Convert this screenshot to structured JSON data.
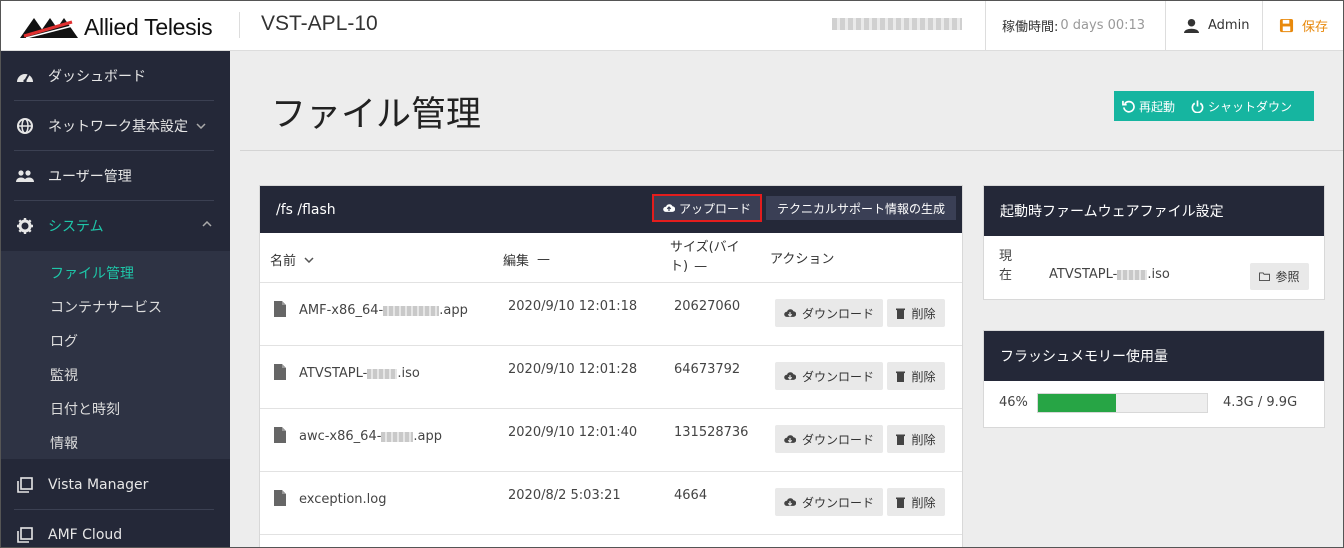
{
  "header": {
    "brand": "Allied Telesis",
    "hostname": "VST-APL-10",
    "uptime_label": "稼働時間:",
    "uptime_value": "0 days 00:13",
    "user": "Admin",
    "save": "保存"
  },
  "sidebar": {
    "items": [
      {
        "label": "ダッシュボード",
        "icon": "dashboard-icon"
      },
      {
        "label": "ネットワーク基本設定",
        "icon": "globe-icon"
      },
      {
        "label": "ユーザー管理",
        "icon": "users-icon"
      },
      {
        "label": "システム",
        "icon": "gear-icon"
      },
      {
        "label": "Vista Manager",
        "icon": "vista-icon"
      },
      {
        "label": "AMF Cloud",
        "icon": "cloud-app-icon"
      }
    ],
    "submenu": [
      "ファイル管理",
      "コンテナサービス",
      "ログ",
      "監視",
      "日付と時刻",
      "情報"
    ]
  },
  "main": {
    "title": "ファイル管理",
    "reboot": "再起動",
    "shutdown": "シャットダウン"
  },
  "files_panel": {
    "path": "/fs /flash",
    "upload": "アップロード",
    "techsupport": "テクニカルサポート情報の生成",
    "columns": {
      "name": "名前",
      "modified": "編集",
      "size_line1": "サイズ(バイ",
      "size_line2": "ト)",
      "actions": "アクション"
    },
    "download": "ダウンロード",
    "delete": "削除",
    "rows": [
      {
        "name_prefix": "AMF-x86_64-",
        "name_suffix": ".app",
        "date": "2020/9/10 12:01:18",
        "size": "20627060"
      },
      {
        "name_prefix": "ATVSTAPL-",
        "name_suffix": ".iso",
        "date": "2020/9/10 12:01:28",
        "size": "64673792"
      },
      {
        "name_prefix": "awc-x86_64-",
        "name_suffix": ".app",
        "date": "2020/9/10 12:01:40",
        "size": "131528736"
      },
      {
        "name_prefix": "exception.log",
        "name_suffix": "",
        "date": "2020/8/2 5:03:21",
        "size": "4664"
      }
    ]
  },
  "boot_panel": {
    "title": "起動時ファームウェアファイル設定",
    "label_l1": "現",
    "label_l2": "在",
    "file_prefix": "ATVSTAPL-",
    "file_suffix": ".iso",
    "browse": "参照"
  },
  "flash_panel": {
    "title": "フラッシュメモリー使用量",
    "percent_text": "46%",
    "percent": 46,
    "usage": "4.3G / 9.9G"
  },
  "colors": {
    "accent": "#1ec6a8",
    "sidebar": "#242838",
    "save": "#e8890c",
    "bar": "#27a545",
    "highlight": "#e31d1d"
  }
}
